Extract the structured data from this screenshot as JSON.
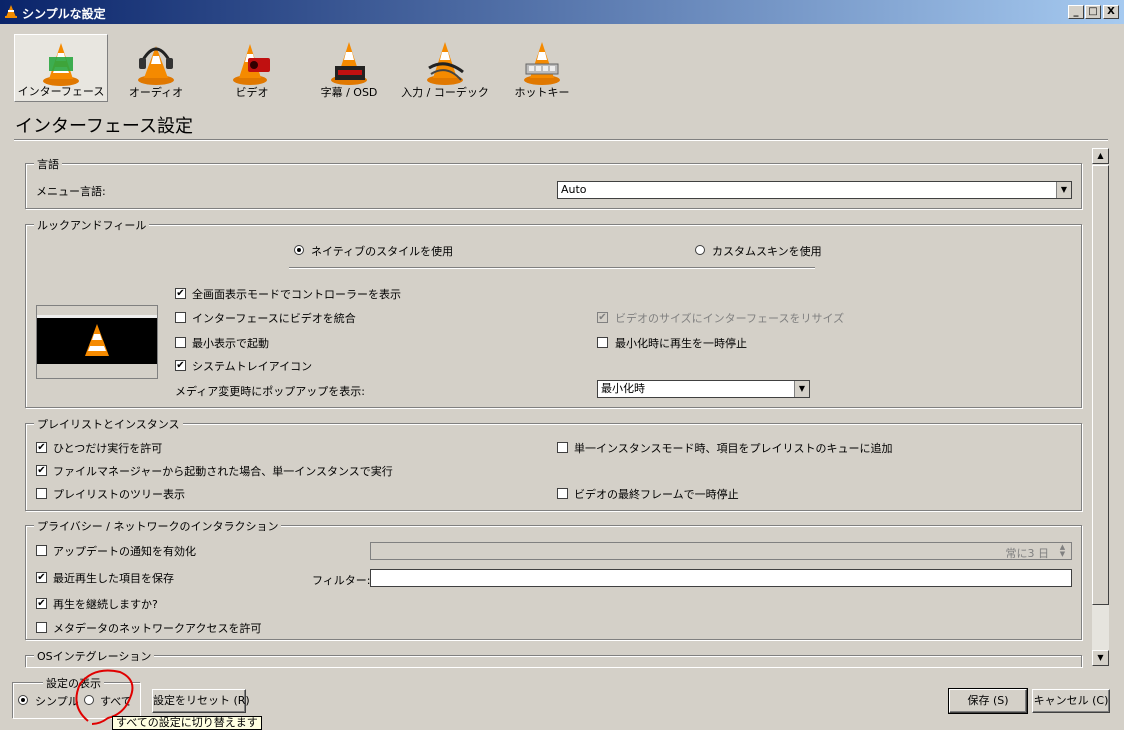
{
  "window": {
    "title": "シンプルな設定"
  },
  "title_buttons": {
    "minimize": "_",
    "maximize": "□",
    "close": "X"
  },
  "categories": [
    {
      "label": "インターフェース",
      "icon": "interface-cone-icon"
    },
    {
      "label": "オーディオ",
      "icon": "audio-headphones-icon"
    },
    {
      "label": "ビデオ",
      "icon": "video-cone-icon"
    },
    {
      "label": "字幕 / OSD",
      "icon": "subtitles-cone-icon"
    },
    {
      "label": "入力 / コーデック",
      "icon": "input-codec-cone-icon"
    },
    {
      "label": "ホットキー",
      "icon": "hotkeys-cone-icon"
    }
  ],
  "section_title": "インターフェース設定",
  "language": {
    "group": "言語",
    "menu_label": "メニュー言語:",
    "menu_value": "Auto"
  },
  "look": {
    "group": "ルックアンドフィール",
    "native_style": "ネイティブのスタイルを使用",
    "custom_skin": "カスタムスキンを使用",
    "fullscreen_controller": "全画面表示モードでコントローラーを表示",
    "integrate_video": "インターフェースにビデオを統合",
    "start_minimal": "最小表示で起動",
    "systray": "システムトレイアイコン",
    "resize_to_video": "ビデオのサイズにインターフェースをリサイズ",
    "pause_minimized": "最小化時に再生を一時停止",
    "popup_label": "メディア変更時にポップアップを表示:",
    "popup_value": "最小化時"
  },
  "playlist": {
    "group": "プレイリストとインスタンス",
    "one_instance": "ひとつだけ実行を許可",
    "file_manager": "ファイルマネージャーから起動された場合、単一インスタンスで実行",
    "tree_view": "プレイリストのツリー表示",
    "enqueue": "単一インスタンスモード時、項目をプレイリストのキューに追加",
    "pause_last_frame": "ビデオの最終フレームで一時停止"
  },
  "privacy": {
    "group": "プライバシー / ネットワークのインタラクション",
    "update_notify": "アップデートの通知を有効化",
    "update_interval": "常に3 日",
    "save_recent": "最近再生した項目を保存",
    "filter_label": "フィルター:",
    "filter_value": "",
    "resume": "再生を継続しますか?",
    "metadata_net": "メタデータのネットワークアクセスを許可"
  },
  "os": {
    "group": "OSインテグレーション"
  },
  "show_settings": {
    "group": "設定の表示",
    "simple": "シンプル",
    "all": "すべて"
  },
  "buttons": {
    "reset": "設定をリセット (R)",
    "save": "保存 (S)",
    "cancel": "キャンセル (C)"
  },
  "tooltip": "すべての設定に切り替えます",
  "colors": {
    "titlebar": "#0a246a",
    "annotation": "#e00000"
  }
}
